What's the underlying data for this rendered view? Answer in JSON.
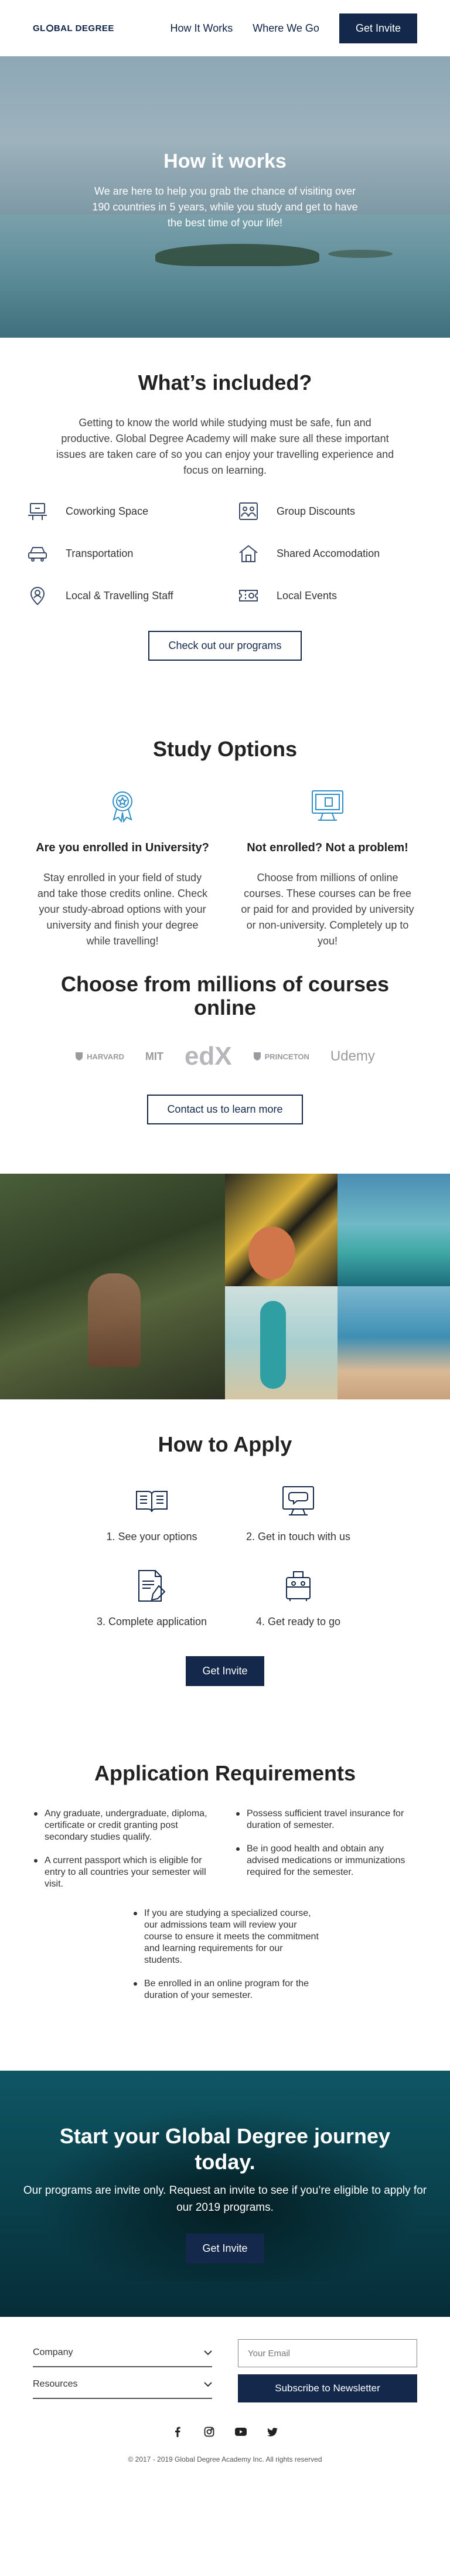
{
  "header": {
    "logo": "GL",
    "logo_rest": "BAL DEGREE",
    "nav": [
      "How It Works",
      "Where We Go"
    ],
    "cta": "Get Invite"
  },
  "hero": {
    "title": "How it works",
    "text": "We are here to help you grab the chance of visiting over 190 countries in 5 years, while you study and get to have the best time of your life!"
  },
  "included": {
    "title": "What’s included?",
    "intro": "Getting to know the world while studying must be safe, fun and productive. Global Degree Academy will make sure all these important issues are taken care of so you can enjoy your travelling experience and focus on learning.",
    "features": [
      {
        "label": "Coworking Space",
        "icon": "laptop-desk-icon"
      },
      {
        "label": "Group Discounts",
        "icon": "group-badge-icon"
      },
      {
        "label": "Transportation",
        "icon": "car-icon"
      },
      {
        "label": "Shared Accomodation",
        "icon": "house-icon"
      },
      {
        "label": "Local & Travelling Staff",
        "icon": "staff-pin-icon"
      },
      {
        "label": "Local Events",
        "icon": "event-ticket-icon"
      }
    ],
    "button": "Check out our programs"
  },
  "study": {
    "title": "Study Options",
    "cols": [
      {
        "heading": "Are you enrolled in University?",
        "text": "Stay enrolled in your field of study and take those credits online. Check your study-abroad options with your university and finish your degree while travelling!",
        "icon": "award-medal-icon"
      },
      {
        "heading": "Not enrolled? Not a problem!",
        "text": "Choose from millions of online courses. These courses can be free or paid for and provided by university or non-university. Completely up to you!",
        "icon": "computer-monitor-icon"
      }
    ]
  },
  "courses": {
    "title": "Choose from millions of courses online",
    "logos": [
      "HARVARD",
      "MIT",
      "edX",
      "PRINCETON",
      "Udemy"
    ],
    "button": "Contact us to learn more"
  },
  "apply": {
    "title": "How to Apply",
    "steps": [
      {
        "label": "1. See your options",
        "icon": "open-book-icon"
      },
      {
        "label": "2. Get in touch with us",
        "icon": "chat-monitor-icon"
      },
      {
        "label": "3. Complete application",
        "icon": "document-pen-icon"
      },
      {
        "label": "4. Get ready to go",
        "icon": "luggage-icon"
      }
    ],
    "button": "Get Invite"
  },
  "requirements": {
    "title": "Application Requirements",
    "left": [
      "Any graduate, undergraduate, diploma, certificate or credit granting post secondary studies qualify.",
      "A current passport which is eligible for entry to all countries your semester will visit."
    ],
    "right": [
      "Possess sufficient travel insurance for duration of semester.",
      "Be in good health and obtain any advised medications or immunizations required for the semester."
    ],
    "center": [
      "If you are studying a specialized course, our admissions team will review your course to ensure it meets the commitment and learning requirements for our students.",
      "Be enrolled in an online program for the duration of your semester."
    ]
  },
  "journey": {
    "title": "Start your Global Degree journey today.",
    "text": "Our programs are invite only. Request an invite to see if you’re eligible to apply for our 2019 programs.",
    "button": "Get Invite"
  },
  "footer": {
    "accordions": [
      "Company",
      "Resources"
    ],
    "email_placeholder": "Your Email",
    "subscribe": "Subscribe to Newsletter",
    "social": [
      "facebook-icon",
      "instagram-icon",
      "youtube-icon",
      "twitter-icon"
    ],
    "copyright": "© 2017 - 2019 Global Degree Academy Inc. All rights reserved"
  }
}
